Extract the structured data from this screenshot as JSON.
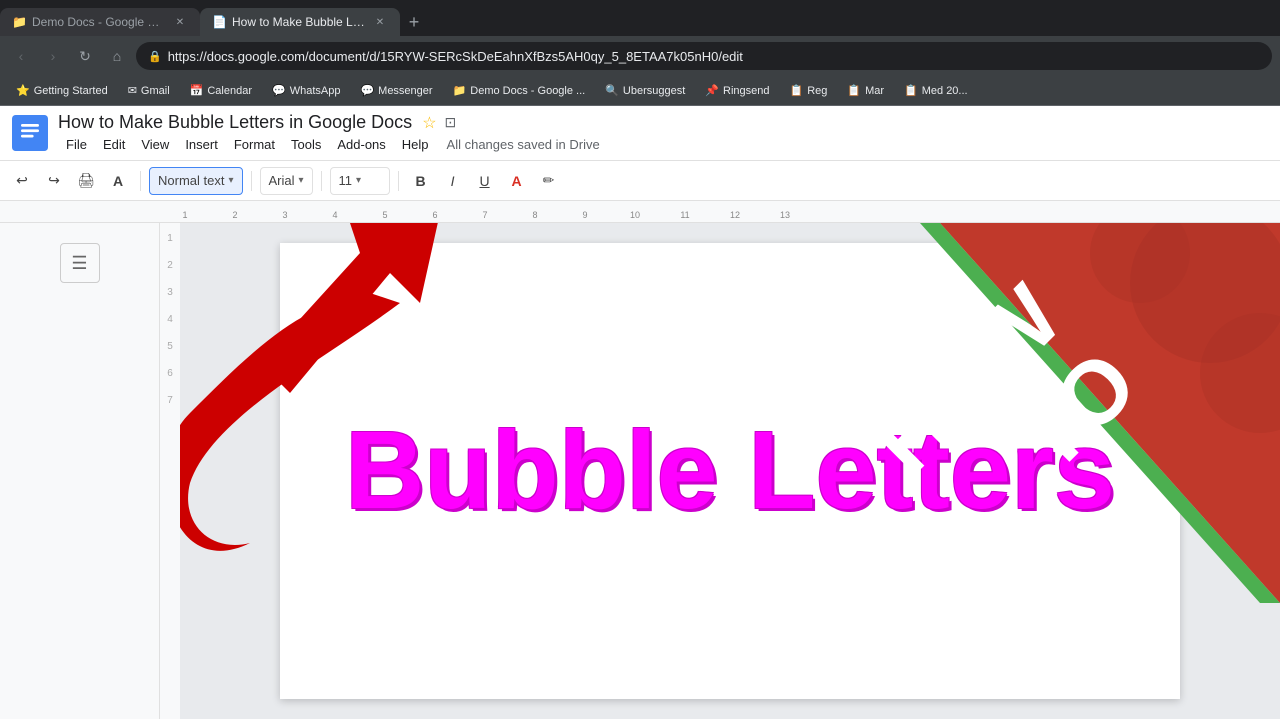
{
  "browser": {
    "tabs": [
      {
        "id": "tab-drive",
        "label": "Demo Docs - Google Drive",
        "favicon": "📁",
        "active": false
      },
      {
        "id": "tab-docs",
        "label": "How to Make Bubble Letters ...",
        "favicon": "📄",
        "active": true
      }
    ],
    "new_tab_label": "+",
    "address": "https://docs.google.com/document/d/15RYW-SERcSkDeEahnXfBzs5AH0qy_5_8ETAA7k05nH0/edit",
    "nav": {
      "back": "‹",
      "forward": "›",
      "refresh": "↻",
      "home": "⌂"
    },
    "bookmarks": [
      {
        "label": "Getting Started",
        "favicon": "⭐"
      },
      {
        "label": "Gmail",
        "favicon": "✉"
      },
      {
        "label": "Calendar",
        "favicon": "📅"
      },
      {
        "label": "WhatsApp",
        "favicon": "💬"
      },
      {
        "label": "Messenger",
        "favicon": "💬"
      },
      {
        "label": "Demo Docs - Google ...",
        "favicon": "📁"
      },
      {
        "label": "Ubersuggest",
        "favicon": "🔍"
      },
      {
        "label": "Ringsend",
        "favicon": "📌"
      },
      {
        "label": "Reg",
        "favicon": "📋"
      },
      {
        "label": "Mar",
        "favicon": "📋"
      },
      {
        "label": "Med 20...",
        "favicon": "📋"
      }
    ]
  },
  "docs": {
    "title": "How to Make Bubble Letters in Google Docs",
    "saved_status": "All changes saved in Drive",
    "logo_initial": "≡",
    "menu": [
      "File",
      "Edit",
      "View",
      "Insert",
      "Format",
      "Tools",
      "Add-ons",
      "Help"
    ],
    "toolbar": {
      "undo": "↩",
      "redo": "↪",
      "print": "🖨",
      "paint_format": "A",
      "text_style_label": "Normal text",
      "text_style_arrow": "▾",
      "font_label": "Arial",
      "font_arrow": "▾",
      "font_size": "11",
      "font_size_arrow": "▾",
      "bold": "B",
      "italic": "I",
      "underline": "U",
      "color": "A",
      "highlight": "✏"
    },
    "ruler_marks": [
      "1",
      "2",
      "3",
      "4",
      "5",
      "6",
      "7",
      "8",
      "9",
      "10",
      "11",
      "12",
      "13"
    ],
    "line_numbers": [
      "1",
      "2",
      "3",
      "4",
      "5",
      "6",
      "7"
    ],
    "bubble_text": "Bubble Letters",
    "bubble_color": "#ff00ff"
  },
  "overlay": {
    "how_to_line1": "HOW",
    "how_to_line2": "TO",
    "how_to_color": "#ffffff"
  }
}
